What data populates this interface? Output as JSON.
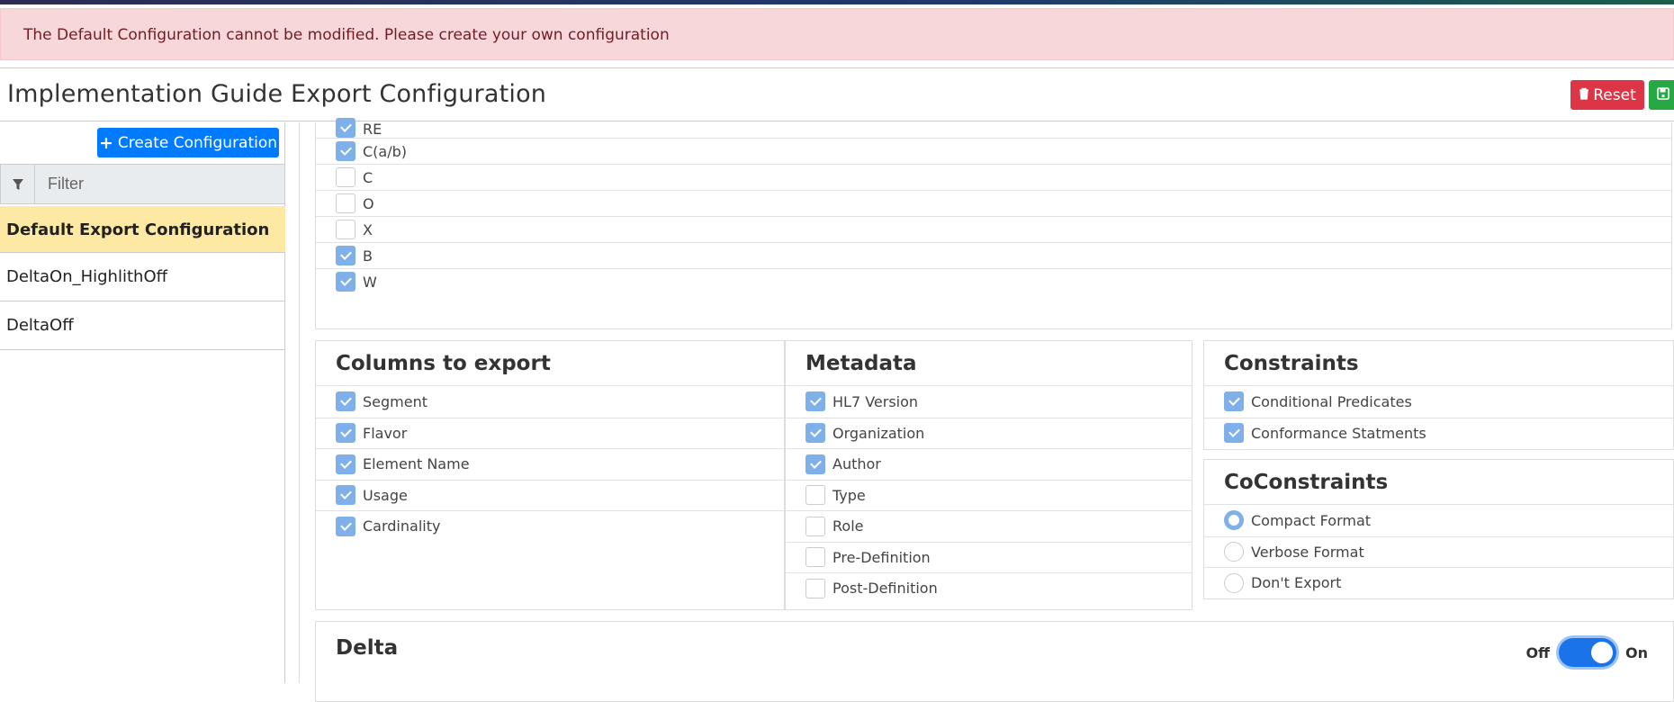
{
  "alert": {
    "message": "The Default Configuration cannot be modified. Please create your own configuration"
  },
  "header": {
    "title": "Implementation Guide Export Configuration",
    "reset_label": "Reset",
    "save_icon": "save-icon"
  },
  "sidebar": {
    "create_label": "Create Configuration",
    "filter_placeholder": "Filter",
    "filter_value": "",
    "items": [
      {
        "label": "Default Export Configuration",
        "active": true
      },
      {
        "label": "DeltaOn_HighlithOff",
        "active": false
      },
      {
        "label": "DeltaOff",
        "active": false
      }
    ]
  },
  "usage": {
    "items": [
      {
        "label": "RE",
        "checked": true
      },
      {
        "label": "C(a/b)",
        "checked": true
      },
      {
        "label": "C",
        "checked": false
      },
      {
        "label": "O",
        "checked": false
      },
      {
        "label": "X",
        "checked": false
      },
      {
        "label": "B",
        "checked": true
      },
      {
        "label": "W",
        "checked": true
      }
    ]
  },
  "columns": {
    "title": "Columns to export",
    "items": [
      {
        "label": "Segment",
        "checked": true
      },
      {
        "label": "Flavor",
        "checked": true
      },
      {
        "label": "Element Name",
        "checked": true
      },
      {
        "label": "Usage",
        "checked": true
      },
      {
        "label": "Cardinality",
        "checked": true
      }
    ]
  },
  "metadata": {
    "title": "Metadata",
    "items": [
      {
        "label": "HL7 Version",
        "checked": true
      },
      {
        "label": "Organization",
        "checked": true
      },
      {
        "label": "Author",
        "checked": true
      },
      {
        "label": "Type",
        "checked": false
      },
      {
        "label": "Role",
        "checked": false
      },
      {
        "label": "Pre-Definition",
        "checked": false
      },
      {
        "label": "Post-Definition",
        "checked": false
      }
    ]
  },
  "constraints": {
    "title": "Constraints",
    "items": [
      {
        "label": "Conditional Predicates",
        "checked": true
      },
      {
        "label": "Conformance Statments",
        "checked": true
      }
    ]
  },
  "coconstraints": {
    "title": "CoConstraints",
    "options": [
      {
        "label": "Compact Format",
        "selected": true
      },
      {
        "label": "Verbose Format",
        "selected": false
      },
      {
        "label": "Don't Export",
        "selected": false
      }
    ]
  },
  "delta": {
    "title": "Delta",
    "off_label": "Off",
    "on_label": "On",
    "enabled": true
  },
  "colors": {
    "primary": "#007bff",
    "danger": "#dc3545",
    "success": "#28a745",
    "checkbox": "#7fb0e9",
    "active_item": "#fde9a3",
    "alert_bg": "#f8d7da"
  }
}
